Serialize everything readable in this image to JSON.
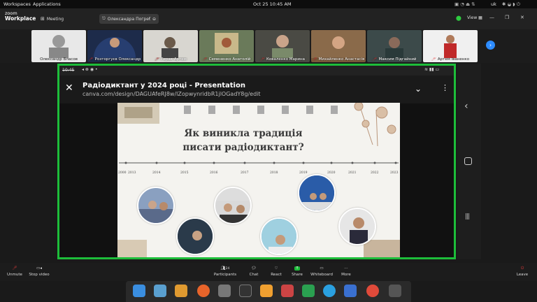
{
  "system_bar": {
    "workspaces": "Workspaces",
    "applications": "Applications",
    "clock": "Oct 25  10:45 AM",
    "lang": "uk"
  },
  "zoom": {
    "logo_line1": "zoom",
    "logo_line2": "Workplace",
    "meeting_label": "Meeting",
    "presenter_tab": "Олександра Погреби...",
    "view_label": "View"
  },
  "participants": [
    {
      "name": "Олександр Власов",
      "muted": false
    },
    {
      "name": "Розторгуєв Олександр",
      "muted": true
    },
    {
      "name": "Герак Артем",
      "muted": true
    },
    {
      "name": "Семененко Анатолій",
      "muted": true
    },
    {
      "name": "Коваленко Марина",
      "muted": true
    },
    {
      "name": "Михайленко Анастасія",
      "muted": true
    },
    {
      "name": "Максим Підгайний",
      "muted": true
    },
    {
      "name": "Артем Іваненко",
      "muted": true
    }
  ],
  "share": {
    "phone_time": "10:45",
    "title": "Радіодиктант у 2024 році - Presentation",
    "url": "canva.com/design/DAGUAfeRJ8w/lZopwynridbR1jlOGadY8g/edit",
    "slide": {
      "heading_line1": "Як виникла традиція",
      "heading_line2": "писати радіодиктант?",
      "years": [
        "2000",
        "2013",
        "2014",
        "2015",
        "2016",
        "2017",
        "2018",
        "2019",
        "2020",
        "2021",
        "2022",
        "2023"
      ]
    }
  },
  "toolbar": {
    "unmute": "Unmute",
    "stop_video": "Stop video",
    "participants": "Participants",
    "participants_count": "24",
    "chat": "Chat",
    "react": "React",
    "share": "Share",
    "whiteboard": "Whiteboard",
    "more": "More",
    "leave": "Leave"
  }
}
